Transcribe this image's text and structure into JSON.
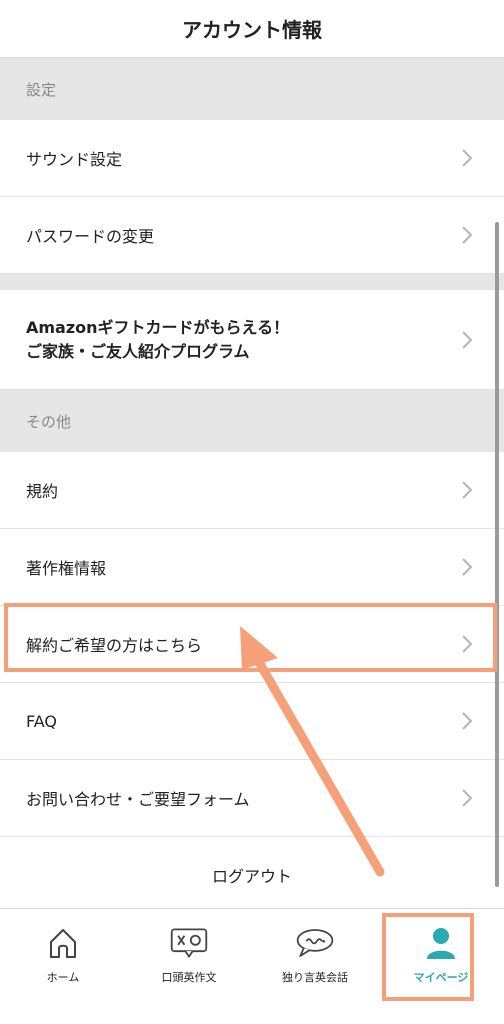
{
  "header": {
    "title": "アカウント情報"
  },
  "sections": {
    "settings_header": "設定",
    "other_header": "その他"
  },
  "rows": {
    "sound": "サウンド設定",
    "password": "パスワードの変更",
    "amazon_line1": "Amazonギフトカードがもらえる！",
    "amazon_line2": "ご家族・ご友人紹介プログラム",
    "terms": "規約",
    "copyright": "著作権情報",
    "cancel": "解約ご希望の方はこちら",
    "faq": "FAQ",
    "contact": "お問い合わせ・ご要望フォーム",
    "logout": "ログアウト"
  },
  "tabbar": {
    "items": [
      {
        "label": "ホーム",
        "icon": "home-icon"
      },
      {
        "label": "口頭英作文",
        "icon": "oral-composition-icon"
      },
      {
        "label": "独り言英会話",
        "icon": "speech-bubble-icon"
      },
      {
        "label": "マイページ",
        "icon": "person-icon"
      }
    ],
    "active_color": "#2aa8b4"
  },
  "colors": {
    "highlight": "#f6a07a",
    "section_bg": "#e6e6e6"
  }
}
